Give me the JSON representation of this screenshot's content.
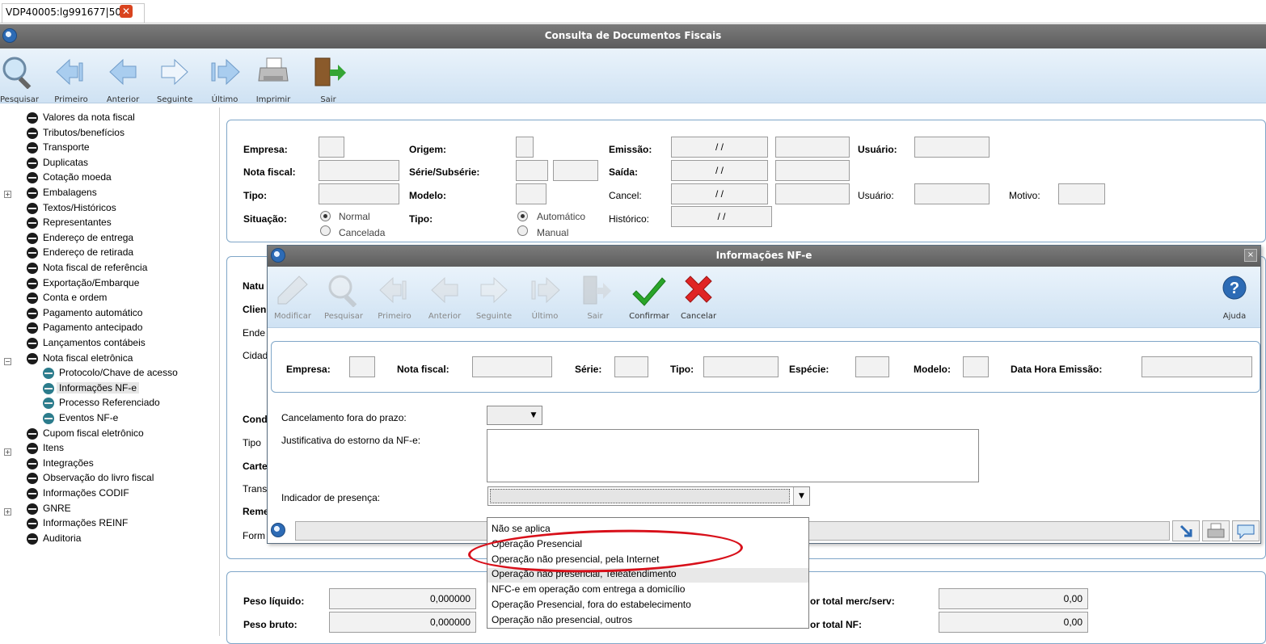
{
  "tab": {
    "label": "VDP40005:lg991677|50"
  },
  "window": {
    "title": "Consulta de Documentos Fiscais"
  },
  "toolbar": [
    {
      "label": "Pesquisar",
      "icon": "search-icon"
    },
    {
      "label": "Primeiro",
      "icon": "first-arrow-icon"
    },
    {
      "label": "Anterior",
      "icon": "previous-arrow-icon"
    },
    {
      "label": "Seguinte",
      "icon": "next-arrow-icon"
    },
    {
      "label": "Último",
      "icon": "last-arrow-icon"
    },
    {
      "label": "Imprimir",
      "icon": "printer-icon"
    },
    {
      "label": "Sair",
      "icon": "exit-door-icon"
    }
  ],
  "tree": [
    "Valores da nota fiscal",
    "Tributos/benefícios",
    "Transporte",
    "Duplicatas",
    "Cotação moeda",
    "Embalagens",
    "Textos/Históricos",
    "Representantes",
    "Endereço de entrega",
    "Endereço de retirada",
    "Nota fiscal de referência",
    "Exportação/Embarque",
    "Conta e ordem",
    "Pagamento automático",
    "Pagamento antecipado",
    "Lançamentos contábeis",
    "Nota fiscal eletrônica",
    "Protocolo/Chave de acesso",
    "Informações NF-e",
    "Processo Referenciado",
    "Eventos NF-e",
    "Cupom fiscal eletrônico",
    "Itens",
    "Integrações",
    "Observação do livro fiscal",
    "Informações CODIF",
    "GNRE",
    "Informações REINF",
    "Auditoria"
  ],
  "header": {
    "empresa": "Empresa:",
    "nota_fiscal": "Nota fiscal:",
    "tipo": "Tipo:",
    "situacao": "Situação:",
    "situacao_normal": "Normal",
    "situacao_cancelada": "Cancelada",
    "origem": "Origem:",
    "serie": "Série/Subsérie:",
    "modelo": "Modelo:",
    "tipo2": "Tipo:",
    "tipo_auto": "Automático",
    "tipo_manual": "Manual",
    "emissao": "Emissão:",
    "saida": "Saída:",
    "cancel": "Cancel:",
    "historico": "Histórico:",
    "usuario1": "Usuário:",
    "usuario2": "Usuário:",
    "motivo": "Motivo:",
    "date_placeholder": "/ /"
  },
  "mid_labels": [
    "Natu",
    "Clien",
    "Ende",
    "Cidad",
    "Cond",
    "Tipo",
    "Carte",
    "Trans",
    "Reme",
    "Form"
  ],
  "totals": {
    "peso_liquido": "Peso líquido:",
    "peso_liquido_val": "0,000000",
    "peso_bruto": "Peso bruto:",
    "peso_bruto_val": "0,000000",
    "total_merc": "or total merc/serv:",
    "total_merc_val": "0,00",
    "total_nf": "or total NF:",
    "total_nf_val": "0,00"
  },
  "dialog": {
    "title": "Informações NF-e",
    "close": "×",
    "toolbar": [
      {
        "label": "Modificar",
        "icon": "modify-icon"
      },
      {
        "label": "Pesquisar",
        "icon": "search-icon"
      },
      {
        "label": "Primeiro",
        "icon": "first-arrow-icon"
      },
      {
        "label": "Anterior",
        "icon": "previous-arrow-icon"
      },
      {
        "label": "Seguinte",
        "icon": "next-arrow-icon"
      },
      {
        "label": "Último",
        "icon": "last-arrow-icon"
      },
      {
        "label": "Sair",
        "icon": "exit-door-icon"
      },
      {
        "label": "Confirmar",
        "icon": "check-icon"
      },
      {
        "label": "Cancelar",
        "icon": "cancel-x-icon"
      }
    ],
    "help_label": "Ajuda",
    "fields": {
      "empresa": "Empresa:",
      "nota_fiscal": "Nota fiscal:",
      "serie": "Série:",
      "tipo": "Tipo:",
      "especie": "Espécie:",
      "modelo": "Modelo:",
      "data_hora": "Data Hora Emissão:"
    },
    "cancelamento_label": "Cancelamento fora do prazo:",
    "justificativa_label": "Justificativa do estorno da NF-e:",
    "indicador_label": "Indicador de presença:",
    "indicador_options": [
      "Não se aplica",
      "Operação Presencial",
      "Operação não presencial, pela Internet",
      "Operação não presencial, Teleatendimento",
      "NFC-e em operação com entrega a domicílio",
      "Operação Presencial, fora do estabelecimento",
      "Operação não presencial, outros"
    ],
    "highlighted_option_index": 3
  },
  "colors": {
    "annotation_ellipse": "#d8101a",
    "confirm": "#2aa52a",
    "cancel": "#e02424"
  }
}
